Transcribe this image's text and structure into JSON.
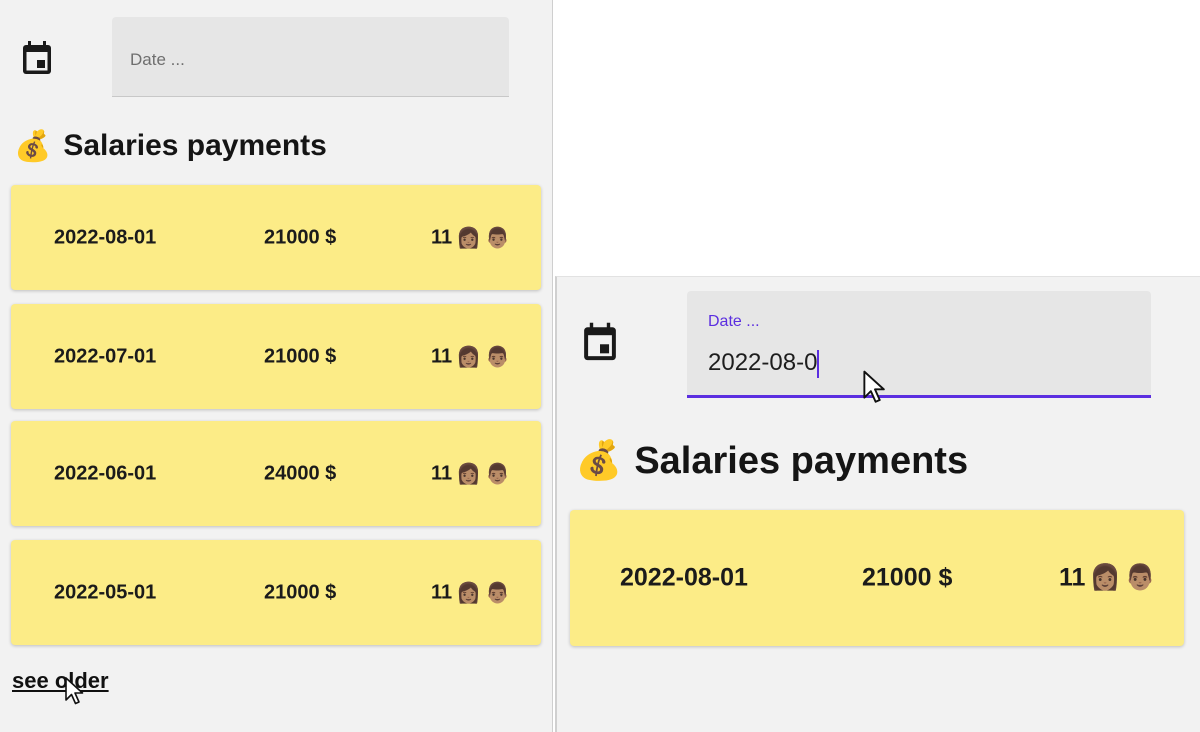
{
  "colors": {
    "card_bg": "#fcec87",
    "panel_bg": "#f2f2f2",
    "field_bg": "#e6e6e6",
    "focus_accent": "#5b2ee0"
  },
  "left_panel": {
    "date_field": {
      "placeholder": "Date ...",
      "icon": "calendar-icon"
    },
    "heading": {
      "emoji": "💰",
      "text": "Salaries payments"
    },
    "payments": [
      {
        "date": "2022-08-01",
        "amount": "21000 $",
        "count": "11",
        "avatars": [
          "👩🏽",
          "👨🏽"
        ]
      },
      {
        "date": "2022-07-01",
        "amount": "21000 $",
        "count": "11",
        "avatars": [
          "👩🏽",
          "👨🏽"
        ]
      },
      {
        "date": "2022-06-01",
        "amount": "24000 $",
        "count": "11",
        "avatars": [
          "👩🏽",
          "👨🏽"
        ]
      },
      {
        "date": "2022-05-01",
        "amount": "21000 $",
        "count": "11",
        "avatars": [
          "👩🏽",
          "👨🏽"
        ]
      }
    ],
    "see_older_label": "see older"
  },
  "right_panel": {
    "date_field": {
      "label": "Date ...",
      "value": "2022-08-0",
      "icon": "calendar-icon"
    },
    "heading": {
      "emoji": "💰",
      "text": "Salaries payments"
    },
    "payments": [
      {
        "date": "2022-08-01",
        "amount": "21000 $",
        "count": "11",
        "avatars": [
          "👩🏽",
          "👨🏽"
        ]
      }
    ]
  }
}
